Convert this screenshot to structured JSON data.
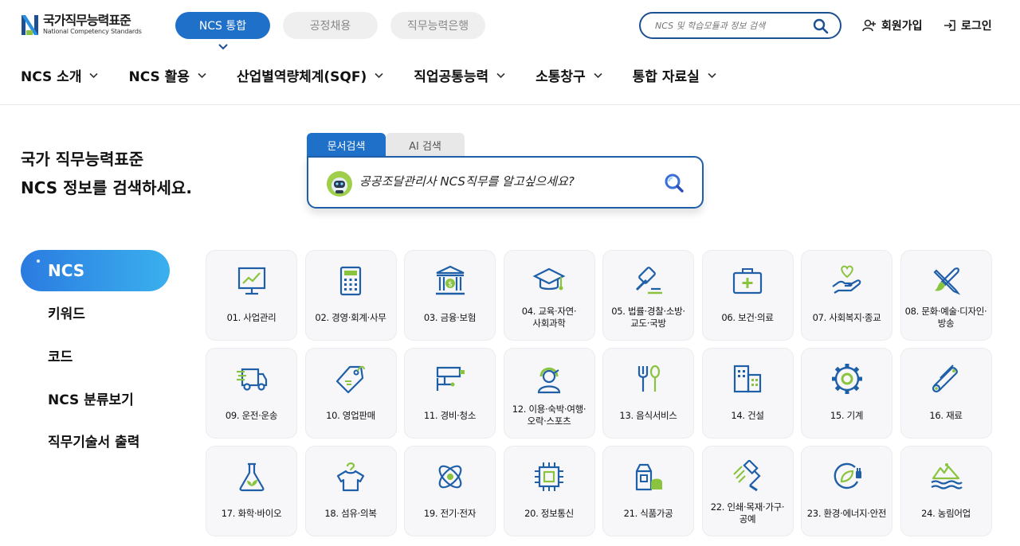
{
  "header": {
    "logo": {
      "kr": "국가직무능력표준",
      "en": "National Competency Standards"
    },
    "top_tabs": [
      {
        "label": "NCS 통합",
        "active": true
      },
      {
        "label": "공정채용",
        "active": false
      },
      {
        "label": "직무능력은행",
        "active": false
      }
    ],
    "search": {
      "placeholder": "NCS 및 학습모듈과 정보 검색"
    },
    "join_label": "회원가입",
    "login_label": "로그인",
    "nav": [
      {
        "label": "NCS 소개"
      },
      {
        "label": "NCS 활용"
      },
      {
        "label": "산업별역량체계(SQF)"
      },
      {
        "label": "직업공통능력"
      },
      {
        "label": "소통창구"
      },
      {
        "label": "통합 자료실"
      }
    ]
  },
  "hero": {
    "line1": "국가 직무능력표준",
    "line2": "NCS 정보를 검색하세요.",
    "tabs": [
      {
        "label": "문서검색",
        "active": true
      },
      {
        "label": "AI 검색",
        "active": false
      }
    ],
    "search_value": "공공조달관리사 NCS직무를 알고싶으세요?"
  },
  "side": {
    "items": [
      {
        "label": "NCS",
        "active": true
      },
      {
        "label": "키워드",
        "active": false
      },
      {
        "label": "코드",
        "active": false
      },
      {
        "label": "NCS 분류보기",
        "active": false
      },
      {
        "label": "직무기술서 출력",
        "active": false
      }
    ]
  },
  "categories": [
    {
      "label": "01. 사업관리",
      "icon": "presentation-chart-icon"
    },
    {
      "label": "02. 경영·회계·사무",
      "icon": "calculator-icon"
    },
    {
      "label": "03. 금융·보험",
      "icon": "bank-icon"
    },
    {
      "label": "04. 교육·자연·\n사회과학",
      "icon": "graduation-cap-icon"
    },
    {
      "label": "05. 법률·경찰·소방·\n교도·국방",
      "icon": "gavel-icon"
    },
    {
      "label": "06. 보건·의료",
      "icon": "first-aid-kit-icon"
    },
    {
      "label": "07. 사회복지·종교",
      "icon": "hand-heart-icon"
    },
    {
      "label": "08. 문화·예술·디자인·\n방송",
      "icon": "brush-pencil-icon"
    },
    {
      "label": "09. 운전·운송",
      "icon": "truck-icon"
    },
    {
      "label": "10. 영업판매",
      "icon": "price-tag-icon"
    },
    {
      "label": "11. 경비·청소",
      "icon": "cctv-camera-icon"
    },
    {
      "label": "12. 이용·숙박·여행·\n오락·스포츠",
      "icon": "hairdresser-icon"
    },
    {
      "label": "13. 음식서비스",
      "icon": "fork-spoon-icon"
    },
    {
      "label": "14. 건설",
      "icon": "buildings-icon"
    },
    {
      "label": "15. 기계",
      "icon": "gear-icon"
    },
    {
      "label": "16. 재료",
      "icon": "pipes-icon"
    },
    {
      "label": "17. 화학·바이오",
      "icon": "flask-icon"
    },
    {
      "label": "18. 섬유·의복",
      "icon": "shirt-hanger-icon"
    },
    {
      "label": "19. 전기·전자",
      "icon": "atom-icon"
    },
    {
      "label": "20. 정보통신",
      "icon": "chip-icon"
    },
    {
      "label": "21. 식품가공",
      "icon": "food-package-icon"
    },
    {
      "label": "22. 인쇄·목재·가구·\n공예",
      "icon": "paint-roller-icon"
    },
    {
      "label": "23. 환경·에너지·안전",
      "icon": "eco-plug-icon"
    },
    {
      "label": "24. 농림어업",
      "icon": "island-wave-icon"
    }
  ],
  "colors": {
    "primary": "#1f70c8",
    "navy": "#1d4f91",
    "accent_green": "#8ac43f"
  }
}
